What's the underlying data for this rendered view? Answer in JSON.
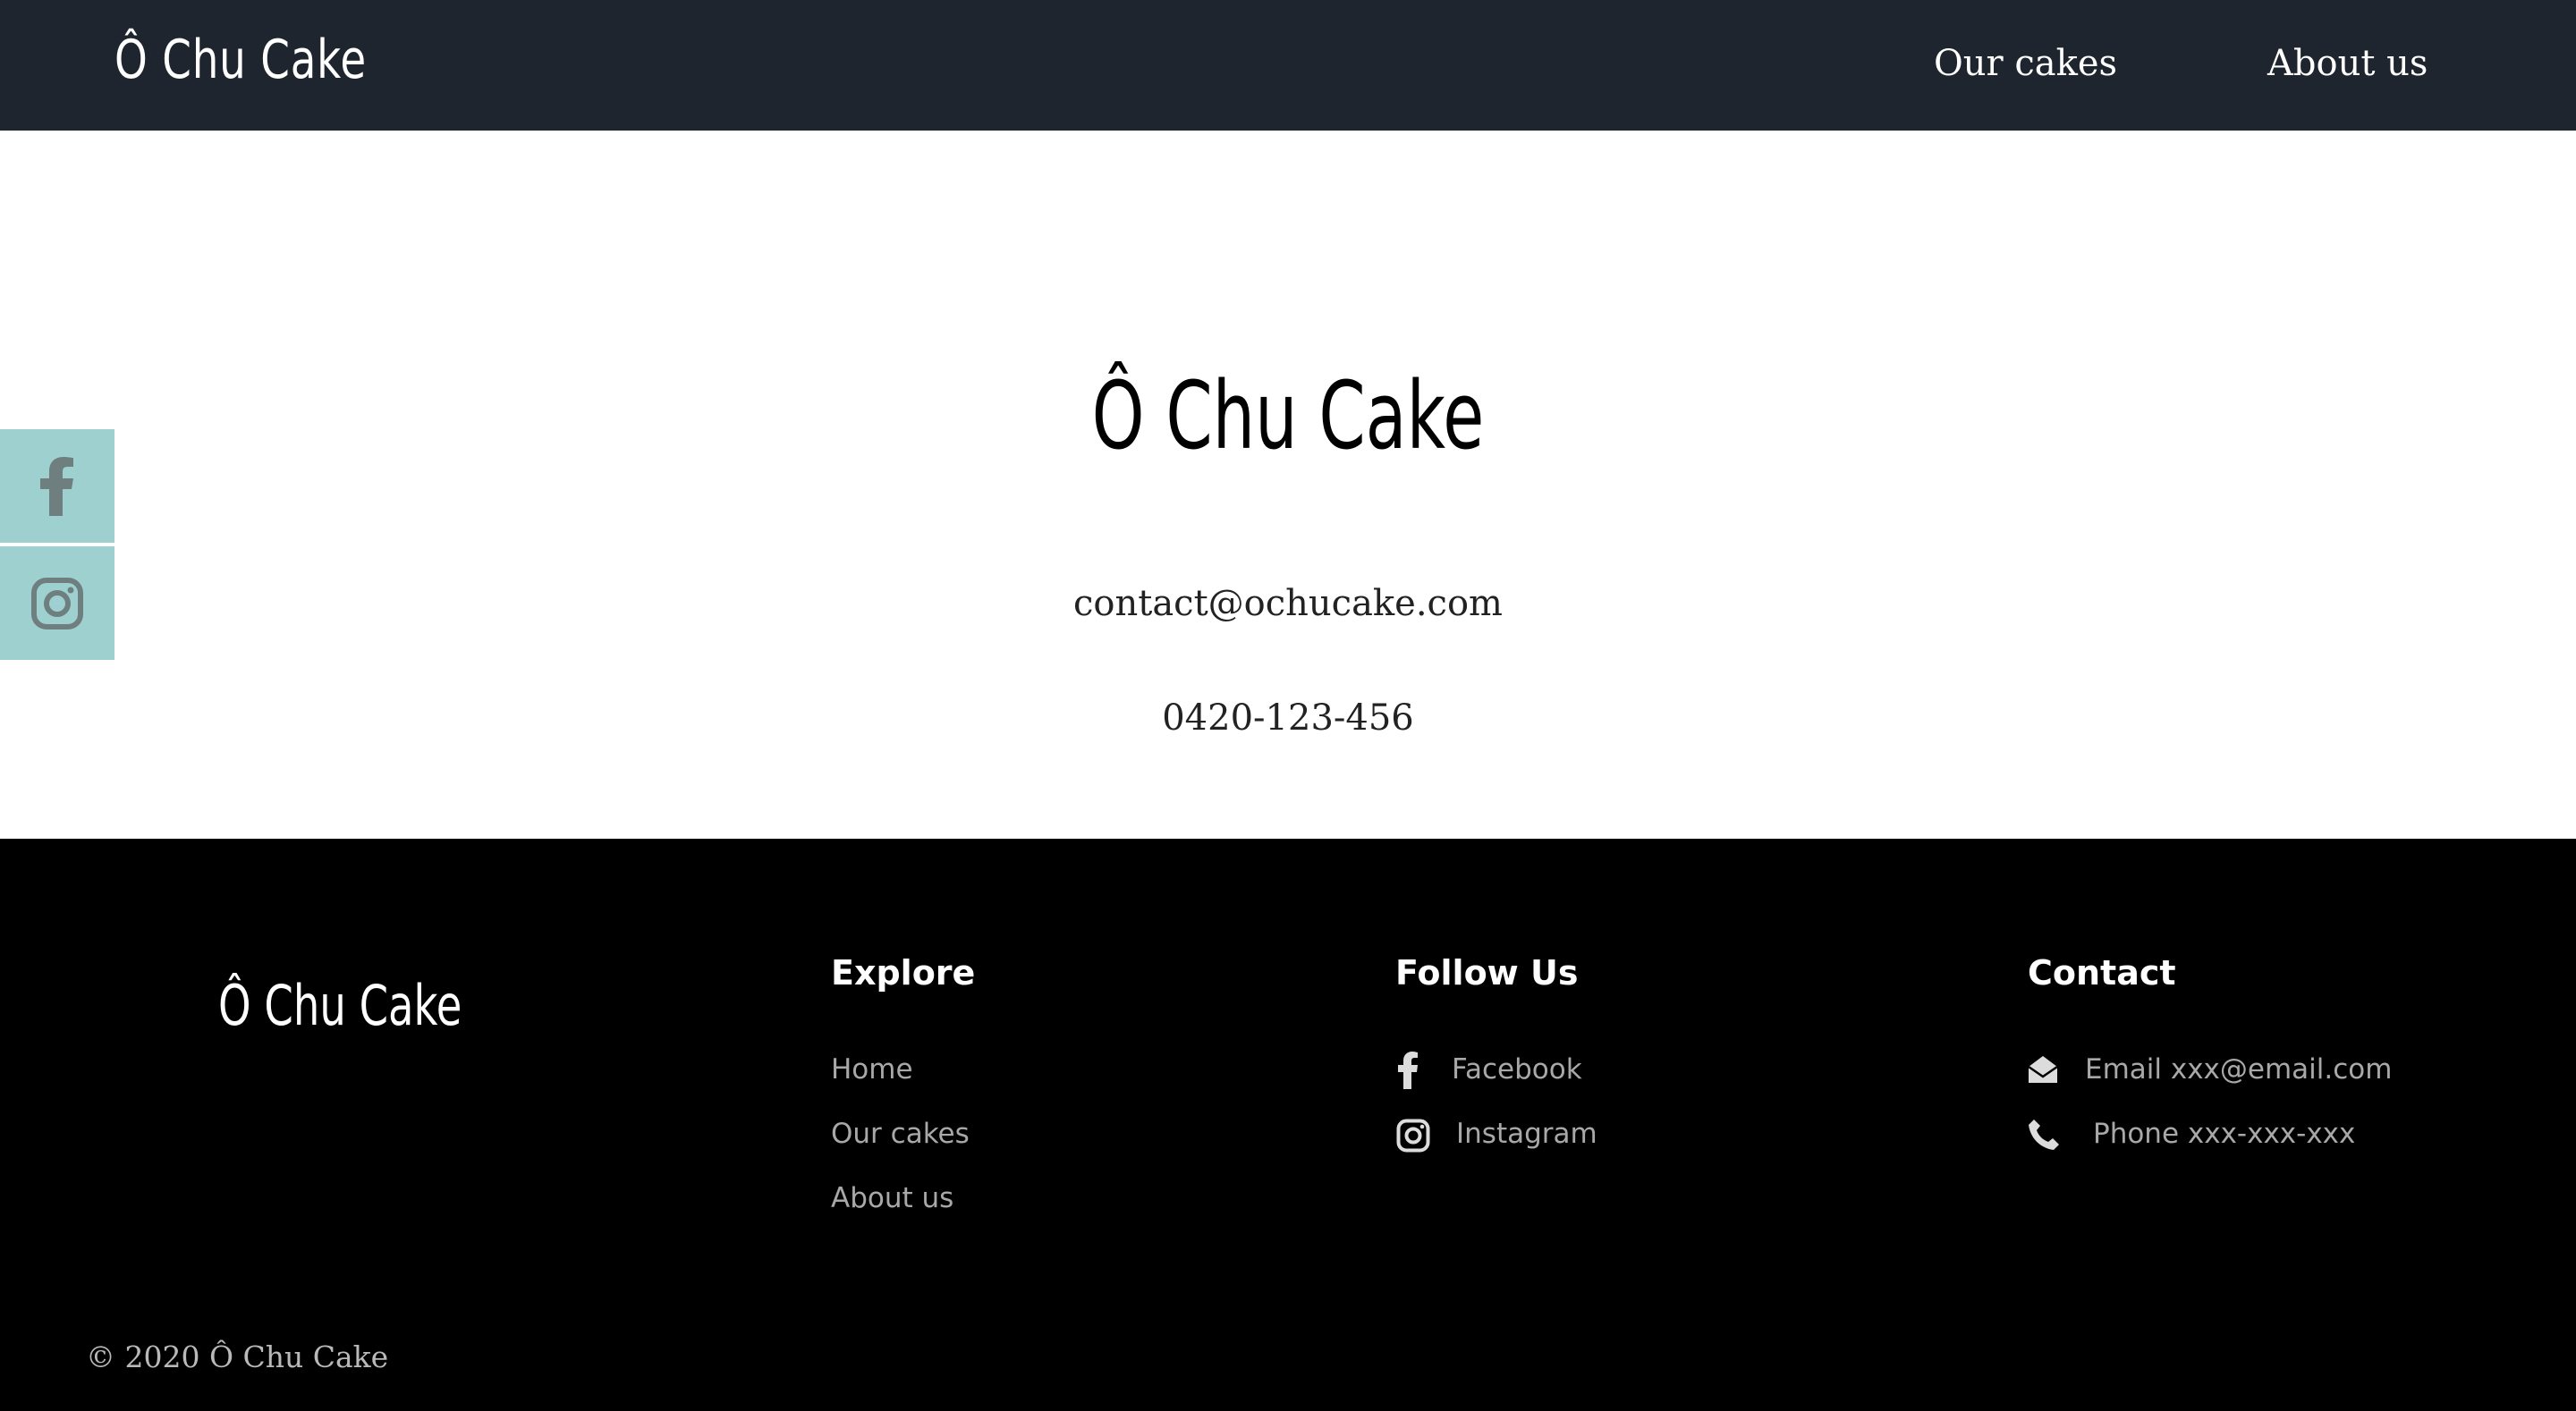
{
  "nav": {
    "logo": "Ô Chu Cake",
    "links": [
      "Our cakes",
      "About us"
    ]
  },
  "hero": {
    "title": "Ô Chu Cake",
    "email": "contact@ochucake.com",
    "phone": "0420-123-456"
  },
  "social_sidebar": {
    "items": [
      {
        "icon": "facebook-icon"
      },
      {
        "icon": "instagram-icon"
      }
    ],
    "bg_color": "#9fd0d0"
  },
  "footer": {
    "logo": "Ô Chu Cake",
    "explore": {
      "heading": "Explore",
      "links": [
        "Home",
        "Our cakes",
        "About us"
      ]
    },
    "follow": {
      "heading": "Follow Us",
      "links": [
        {
          "icon": "facebook-icon",
          "label": "Facebook"
        },
        {
          "icon": "instagram-icon",
          "label": "Instagram"
        }
      ]
    },
    "contact": {
      "heading": "Contact",
      "items": [
        {
          "icon": "email-icon",
          "label": "Email xxx@email.com"
        },
        {
          "icon": "phone-icon",
          "label": "Phone xxx-xxx-xxx"
        }
      ]
    },
    "copyright": "© 2020 Ô Chu Cake"
  },
  "colors": {
    "navbar_bg": "#1f252e",
    "footer_bg": "#000000",
    "social_bg": "#9fd0d0"
  }
}
